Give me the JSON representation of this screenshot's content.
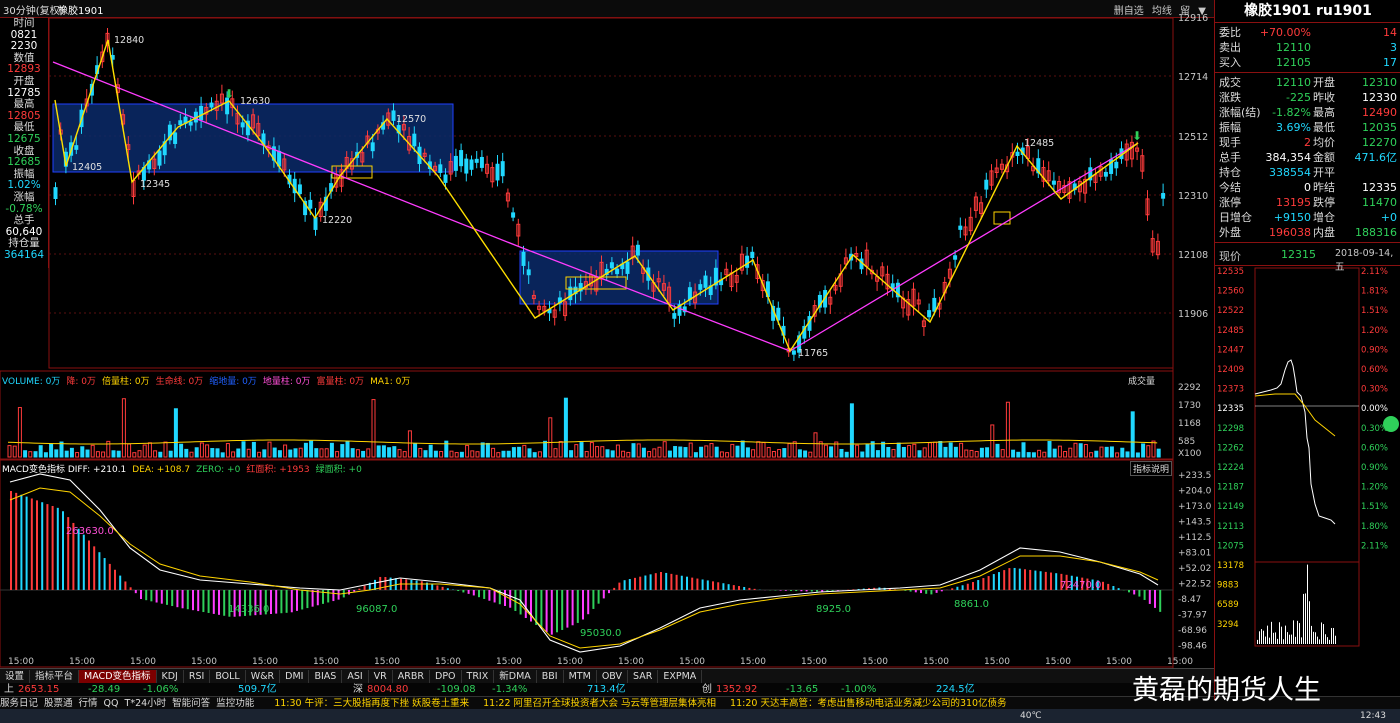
{
  "window": {
    "period": "30分钟(复权)",
    "instrument_small": "橡胶1901",
    "toolbar_items": [
      "删自选",
      "均线",
      "留",
      "▼"
    ]
  },
  "left_info": {
    "rows": [
      {
        "label": "时间",
        "value": "0821",
        "vcolor": "white"
      },
      {
        "label": "",
        "value": "2230",
        "vcolor": "white"
      },
      {
        "label": "数值",
        "value": "12893",
        "vcolor": "red"
      },
      {
        "label": "开盘",
        "value": "12785",
        "vcolor": "white"
      },
      {
        "label": "最高",
        "value": "12805",
        "vcolor": "red"
      },
      {
        "label": "最低",
        "value": "12675",
        "vcolor": "green"
      },
      {
        "label": "收盘",
        "value": "12685",
        "vcolor": "green"
      },
      {
        "label": "振幅",
        "value": "1.02%",
        "vcolor": "cyan"
      },
      {
        "label": "涨幅",
        "value": "-0.78%",
        "vcolor": "green"
      },
      {
        "label": "总手",
        "value": "60,640",
        "vcolor": "white"
      },
      {
        "label": "持仓量",
        "value": "364164",
        "vcolor": "cyan"
      }
    ]
  },
  "main_chart": {
    "price_axis": [
      "12916",
      "12714",
      "12512",
      "12310",
      "12108",
      "11906"
    ],
    "pivot_labels": [
      {
        "text": "12840"
      },
      {
        "text": "12630"
      },
      {
        "text": "12570"
      },
      {
        "text": "12405"
      },
      {
        "text": "12345"
      },
      {
        "text": "12220"
      },
      {
        "text": "11765"
      },
      {
        "text": "12485"
      }
    ]
  },
  "volume_panel": {
    "legend": [
      {
        "text": "VOLUME: 0万",
        "color": "#20d8ff"
      },
      {
        "text": "降: 0万",
        "color": "#ff3b3b"
      },
      {
        "text": "倍量柱: 0万",
        "color": "#ffd400"
      },
      {
        "text": "生命线: 0万",
        "color": "#ff3b3b"
      },
      {
        "text": "缩地量: 0万",
        "color": "#2060ff"
      },
      {
        "text": "地量柱: 0万",
        "color": "#ff4fd8"
      },
      {
        "text": "富量柱: 0万",
        "color": "#ff3b3b"
      },
      {
        "text": "MA1: 0万",
        "color": "#ffd400"
      }
    ],
    "title_right": "成交量",
    "axis": [
      "2292",
      "1730",
      "1168",
      "585",
      "X100"
    ]
  },
  "macd_panel": {
    "legend": [
      {
        "text": "MACD变色指标 DIFF: +210.1",
        "color": "#ffffff"
      },
      {
        "text": "DEA: +108.7",
        "color": "#ffd400"
      },
      {
        "text": "ZERO: +0",
        "color": "#2fd15a"
      },
      {
        "text": "红面积: +1953",
        "color": "#ff3b3b"
      },
      {
        "text": "绿面积: +0",
        "color": "#2fd15a"
      }
    ],
    "button": "指标说明",
    "axis": [
      "+233.5",
      "+204.0",
      "+173.0",
      "+143.5",
      "+112.5",
      "+83.01",
      "+52.02",
      "+22.52",
      "-8.47",
      "-37.97",
      "-68.96",
      "-98.46"
    ],
    "annotations": [
      "263630.0",
      "14336.0",
      "96087.0",
      "95030.0",
      "8925.0",
      "8861.0",
      "72470.0"
    ],
    "time_ticks": [
      "15:00",
      "15:00",
      "15:00",
      "15:00",
      "15:00",
      "15:00",
      "15:00",
      "15:00",
      "15:00",
      "15:00",
      "15:00",
      "15:00",
      "15:00",
      "15:00",
      "15:00",
      "15:00",
      "15:00",
      "15:00",
      "15:00",
      "15:00"
    ]
  },
  "tabs": [
    "设置",
    "指标平台",
    "MACD变色指标",
    "KDJ",
    "RSI",
    "BOLL",
    "W&R",
    "DMI",
    "BIAS",
    "ASI",
    "VR",
    "ARBR",
    "DPO",
    "TRIX",
    "新DMA",
    "BBI",
    "MTM",
    "OBV",
    "SAR",
    "EXPMA"
  ],
  "active_tab": "MACD变色指标",
  "index_bar": {
    "items": [
      {
        "label": "上",
        "value": "2653.15",
        "change": "-28.49",
        "pct": "-1.06%",
        "amount": "509.7亿"
      },
      {
        "label": "深",
        "value": "8004.80",
        "change": "-109.08",
        "pct": "-1.34%",
        "amount": "713.4亿"
      },
      {
        "label": "创",
        "value": "1352.92",
        "change": "-13.65",
        "pct": "-1.00%",
        "amount": "224.5亿"
      }
    ]
  },
  "news_bar": {
    "left_items": [
      "服务日记",
      "股票通",
      "行情",
      "QQ",
      "T*24小时",
      "智能问答",
      "监控功能"
    ],
    "news": [
      "11:30 午评：三大股指再度下挫 妖股卷土重来",
      "11:22 阿里召开全球投资者大会 马云等管理层集体亮相",
      "11:20 天达丰高管：考虑出售移动电话业务减少公司的310亿债务"
    ]
  },
  "right_panel": {
    "title": "橡胶1901 ru1901",
    "rows": [
      {
        "l": "委比",
        "v": "+70.00%",
        "vc": "red",
        "r": "14",
        "rc": "red"
      },
      {
        "l": "卖出",
        "v": "12110",
        "vc": "green",
        "r": "3",
        "rc": "cyan"
      },
      {
        "l": "买入",
        "v": "12105",
        "vc": "green",
        "r": "17",
        "rc": "cyan"
      }
    ],
    "stats": [
      {
        "l1": "成交",
        "v1": "12110",
        "c1": "green",
        "l2": "开盘",
        "v2": "12310",
        "c2": "green"
      },
      {
        "l1": "涨跌",
        "v1": "-225",
        "c1": "green",
        "l2": "昨收",
        "v2": "12330",
        "c2": "white"
      },
      {
        "l1": "涨幅(结)",
        "v1": "-1.82%",
        "c1": "green",
        "l2": "最高",
        "v2": "12490",
        "c2": "red"
      },
      {
        "l1": "振幅",
        "v1": "3.69%",
        "c1": "cyan",
        "l2": "最低",
        "v2": "12035",
        "c2": "green"
      },
      {
        "l1": "现手",
        "v1": "2",
        "c1": "red",
        "l2": "均价",
        "v2": "12270",
        "c2": "green"
      },
      {
        "l1": "总手",
        "v1": "384,354",
        "c1": "white",
        "l2": "金额",
        "v2": "471.6亿",
        "c2": "cyan"
      },
      {
        "l1": "持仓",
        "v1": "338554",
        "c1": "cyan",
        "l2": "开平",
        "v2": "",
        "c2": "white"
      },
      {
        "l1": "今结",
        "v1": "0",
        "c1": "white",
        "l2": "昨结",
        "v2": "12335",
        "c2": "white"
      },
      {
        "l1": "涨停",
        "v1": "13195",
        "c1": "red",
        "l2": "跌停",
        "v2": "11470",
        "c2": "green"
      },
      {
        "l1": "日增仓",
        "v1": "+9150",
        "c1": "cyan",
        "l2": "增仓",
        "v2": "+0",
        "c2": "cyan"
      },
      {
        "l1": "外盘",
        "v1": "196038",
        "c1": "red",
        "l2": "内盘",
        "v2": "188316",
        "c2": "green"
      }
    ],
    "now_label": "现价",
    "now_value": "12315",
    "date": "2018-09-14,五",
    "mini_axis_left": [
      "12535",
      "12560",
      "12522",
      "12485",
      "12447",
      "12409",
      "12373",
      "12335",
      "12298",
      "12262",
      "12224",
      "12187",
      "12149",
      "12113",
      "12075",
      "13178",
      "9883",
      "6589",
      "3294"
    ],
    "mini_axis_right": [
      "2.11%",
      "1.81%",
      "1.51%",
      "1.20%",
      "0.90%",
      "0.60%",
      "0.30%",
      "0.00%",
      "0.30%",
      "0.60%",
      "0.90%",
      "1.20%",
      "1.51%",
      "1.80%",
      "2.11%"
    ]
  },
  "watermark": "黄磊的期货人生",
  "taskbar": {
    "temp": "40℃",
    "time": "12:43"
  }
}
